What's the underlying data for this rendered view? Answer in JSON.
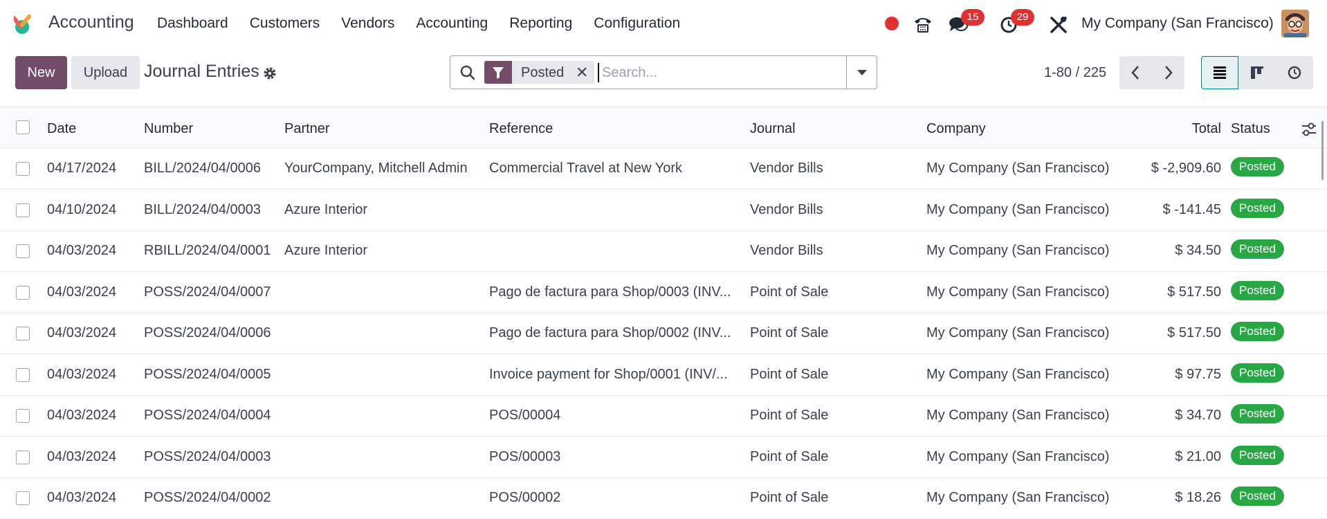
{
  "navbar": {
    "app_name": "Accounting",
    "menu": [
      "Dashboard",
      "Customers",
      "Vendors",
      "Accounting",
      "Reporting",
      "Configuration"
    ],
    "messages_count": "15",
    "activities_count": "29",
    "company": "My Company (San Francisco)"
  },
  "control_panel": {
    "new_label": "New",
    "upload_label": "Upload",
    "title": "Journal Entries",
    "search": {
      "facet": "Posted",
      "placeholder": "Search..."
    },
    "pager": "1-80 / 225"
  },
  "table": {
    "columns": [
      "Date",
      "Number",
      "Partner",
      "Reference",
      "Journal",
      "Company",
      "Total",
      "Status"
    ],
    "rows": [
      {
        "date": "04/17/2024",
        "number": "BILL/2024/04/0006",
        "partner": "YourCompany, Mitchell Admin",
        "reference": "Commercial Travel at New York",
        "journal": "Vendor Bills",
        "company": "My Company (San Francisco)",
        "total": "$ -2,909.60",
        "status": "Posted"
      },
      {
        "date": "04/10/2024",
        "number": "BILL/2024/04/0003",
        "partner": "Azure Interior",
        "reference": "",
        "journal": "Vendor Bills",
        "company": "My Company (San Francisco)",
        "total": "$ -141.45",
        "status": "Posted"
      },
      {
        "date": "04/03/2024",
        "number": "RBILL/2024/04/0001",
        "partner": "Azure Interior",
        "reference": "",
        "journal": "Vendor Bills",
        "company": "My Company (San Francisco)",
        "total": "$ 34.50",
        "status": "Posted"
      },
      {
        "date": "04/03/2024",
        "number": "POSS/2024/04/0007",
        "partner": "",
        "reference": "Pago de factura para Shop/0003 (INV...",
        "journal": "Point of Sale",
        "company": "My Company (San Francisco)",
        "total": "$ 517.50",
        "status": "Posted"
      },
      {
        "date": "04/03/2024",
        "number": "POSS/2024/04/0006",
        "partner": "",
        "reference": "Pago de factura para Shop/0002 (INV...",
        "journal": "Point of Sale",
        "company": "My Company (San Francisco)",
        "total": "$ 517.50",
        "status": "Posted"
      },
      {
        "date": "04/03/2024",
        "number": "POSS/2024/04/0005",
        "partner": "",
        "reference": "Invoice payment for Shop/0001 (INV/...",
        "journal": "Point of Sale",
        "company": "My Company (San Francisco)",
        "total": "$ 97.75",
        "status": "Posted"
      },
      {
        "date": "04/03/2024",
        "number": "POSS/2024/04/0004",
        "partner": "",
        "reference": "POS/00004",
        "journal": "Point of Sale",
        "company": "My Company (San Francisco)",
        "total": "$ 34.70",
        "status": "Posted"
      },
      {
        "date": "04/03/2024",
        "number": "POSS/2024/04/0003",
        "partner": "",
        "reference": "POS/00003",
        "journal": "Point of Sale",
        "company": "My Company (San Francisco)",
        "total": "$ 21.00",
        "status": "Posted"
      },
      {
        "date": "04/03/2024",
        "number": "POSS/2024/04/0002",
        "partner": "",
        "reference": "POS/00002",
        "journal": "Point of Sale",
        "company": "My Company (San Francisco)",
        "total": "$ 18.26",
        "status": "Posted"
      }
    ]
  },
  "colors": {
    "brand": "#714b67",
    "status_posted": "#28a745",
    "badge": "#e03131",
    "view_active": "#017e84"
  },
  "icons": [
    "app-logo-icon",
    "phone-icon",
    "chat-icon",
    "clock-icon",
    "tools-icon",
    "gear-icon",
    "search-icon",
    "filter-icon",
    "close-icon",
    "chevron-left-icon",
    "chevron-right-icon",
    "list-view-icon",
    "kanban-view-icon",
    "activity-view-icon",
    "column-settings-icon"
  ]
}
